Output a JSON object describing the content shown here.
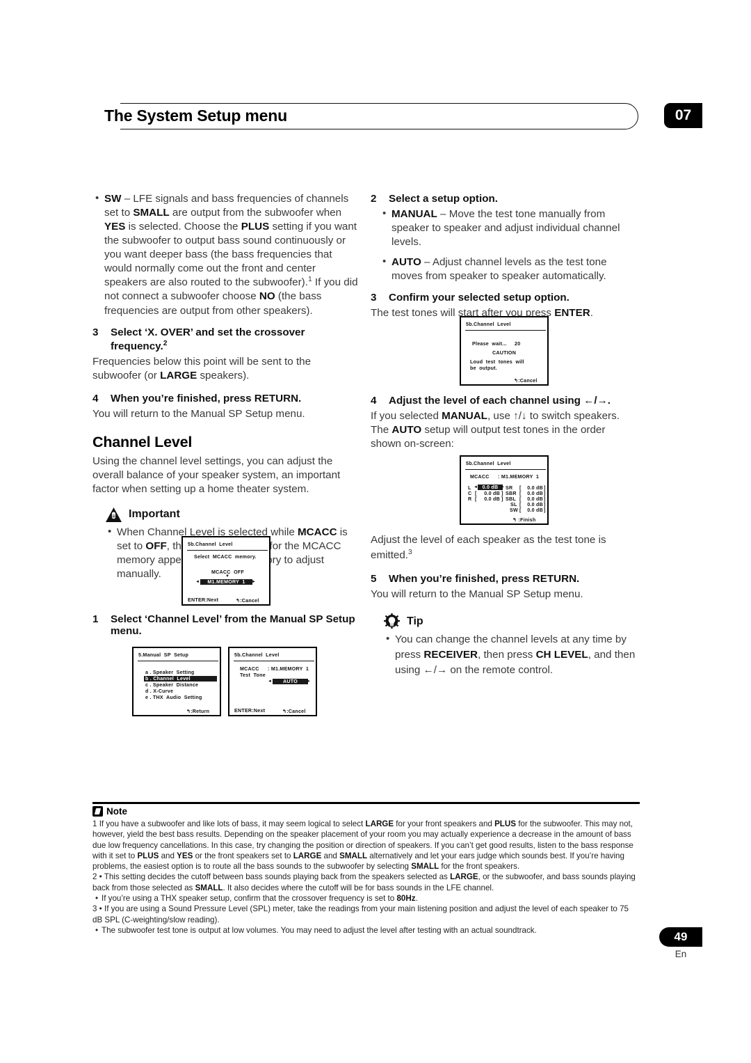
{
  "header": {
    "title": "The System Setup menu",
    "chapter": "07"
  },
  "left_column": {
    "sw_bullet": {
      "lead": "SW",
      "text_1": " – LFE signals and bass frequencies of channels set to ",
      "b_small": "SMALL",
      "text_2": " are output from the subwoofer when ",
      "b_yes": "YES",
      "text_3": " is selected. Choose the ",
      "b_plus": "PLUS",
      "text_4": " setting if you want the subwoofer to output bass sound continuously or you want deeper bass (the bass frequencies that would normally come out the front and center speakers are also routed to the subwoofer).",
      "fn_1": "1",
      "text_5": " If you did not connect a subwoofer choose ",
      "b_no": "NO",
      "text_6": " (the bass frequencies are output from other speakers)."
    },
    "step3": {
      "num": "3",
      "title_a": "Select ‘X. OVER’ and set the crossover frequency.",
      "title_fn": "2",
      "body_a": "Frequencies below this point will be sent to the subwoofer (or ",
      "body_b": "LARGE",
      "body_c": " speakers)."
    },
    "step4": {
      "num": "4",
      "title": "When you’re finished, press RETURN.",
      "body": "You will return to the Manual SP Setup menu."
    },
    "section_title": "Channel Level",
    "section_body": "Using the channel level settings, you can adjust the overall balance of your speaker system, an important factor when setting up a home theater system.",
    "important": {
      "icon": "warning-triangle-icon",
      "label": "Important",
      "text_a": "When Channel Level is selected while ",
      "b_mcacc": "MCACC",
      "text_b": " is set to ",
      "b_off": "OFF",
      "text_c": ", the selection screen for the MCACC memory appears. Select a memory to adjust manually."
    },
    "step1": {
      "num": "1",
      "title": "Select ‘Channel Level’ from the Manual SP Setup menu."
    }
  },
  "right_column": {
    "step2": {
      "num": "2",
      "title": "Select a setup option.",
      "bullet_manual_b": "MANUAL",
      "bullet_manual_t": " – Move the test tone manually from speaker to speaker and adjust individual channel levels.",
      "bullet_auto_b": "AUTO",
      "bullet_auto_t": " – Adjust channel levels as the test tone moves from speaker to speaker automatically."
    },
    "step3": {
      "num": "3",
      "title": "Confirm your selected setup option.",
      "body_a": "The test tones will start after you press ",
      "body_b": "ENTER",
      "body_c": "."
    },
    "step4": {
      "num": "4",
      "title_a": "Adjust the level of each channel using ",
      "title_arrows": "←/→",
      "title_b": ".",
      "body_a": "If you selected ",
      "body_mb": "MANUAL",
      "body_b": ", use ",
      "body_arrows": "↑/↓",
      "body_c": " to switch speakers. The ",
      "body_ab": "AUTO",
      "body_d": " setup will output test tones in the order shown on-screen:"
    },
    "after_osd": {
      "text": "Adjust the level of each speaker as the test tone is emitted.",
      "fn": "3"
    },
    "step5": {
      "num": "5",
      "title": "When you’re finished, press RETURN.",
      "body": "You will return to the Manual SP Setup menu."
    },
    "tip": {
      "icon": "lightbulb-icon",
      "label": "Tip",
      "text_a": "You can change the channel levels at any time by press ",
      "b_receiver": "RECEIVER",
      "text_b": ", then press ",
      "b_chlevel": "CH LEVEL",
      "text_c": ", and then using ",
      "arrows": "←/→",
      "text_d": " on the remote control."
    }
  },
  "osd_screens": {
    "mcacc_memory": {
      "title": "5b.Channel  Level",
      "line1": "Select  MCACC  memory.",
      "line2": "MCACC  OFF",
      "arrow_down": "▼",
      "left_arrow": "◄",
      "selection": "M1.MEMORY  1",
      "right_arrow": "►",
      "footer_left": "ENTER:Next",
      "footer_right": "↰:Cancel"
    },
    "manual_sp_setup": {
      "title": "5.Manual  SP  Setup",
      "items": [
        "a . Speaker  Setting",
        "b . Channel  Level",
        "c . Speaker  Distance",
        "d . X-Curve",
        "e . THX  Audio  Setting"
      ],
      "selected_index": 1,
      "footer_right": "↰:Return"
    },
    "test_tone": {
      "title": "5b.Channel  Level",
      "row1_label": "MCACC",
      "row1_value": ": M1.MEMORY  1",
      "row2_label": "Test  Tone",
      "left_arrow": "◄",
      "selection": "AUTO",
      "right_arrow": "►",
      "footer_left": "ENTER:Next",
      "footer_right": "↰:Cancel"
    },
    "please_wait": {
      "title": "5b.Channel  Level",
      "wait_text": "Please  wait...",
      "wait_count": "20",
      "caution": "CAUTION",
      "warn_line1": "Loud  test  tones  will",
      "warn_line2": "be  output.",
      "footer_right": "↰:Cancel"
    },
    "channel_levels": {
      "title": "5b.Channel  Level",
      "mcacc_label": "MCACC",
      "mcacc_value": ": M1.MEMORY  1",
      "left_rows": [
        {
          "ch": "L",
          "value": "0.0 dB",
          "selected": true
        },
        {
          "ch": "C",
          "value": "0.0 dB",
          "selected": false
        },
        {
          "ch": "R",
          "value": "0.0 dB",
          "selected": false
        }
      ],
      "right_rows": [
        {
          "ch": "SR",
          "value": "0.0 dB"
        },
        {
          "ch": "SBR",
          "value": "0.0 dB"
        },
        {
          "ch": "SBL",
          "value": "0.0 dB"
        },
        {
          "ch": "SL",
          "value": "0.0 dB"
        },
        {
          "ch": "SW",
          "value": "0.0 dB"
        }
      ],
      "left_arrow": "◄",
      "right_arrow": "►",
      "footer_right": "↰ :Finish"
    }
  },
  "notes": {
    "label": "Note",
    "n1": {
      "num": "1",
      "seg_a": "If you have a subwoofer and like lots of bass, it may seem logical to select ",
      "b1": "LARGE",
      "seg_b": " for your front speakers and ",
      "b2": "PLUS",
      "seg_c": " for the subwoofer. This may not, however, yield the best bass results. Depending on the speaker placement of your room you may actually experience a decrease in the amount of bass due low frequency cancellations. In this case, try changing the position or direction of speakers. If you can’t get good results, listen to the bass response with it set to ",
      "b3": "PLUS",
      "seg_d": " and ",
      "b4": "YES",
      "seg_e": " or the front speakers set to ",
      "b5": "LARGE",
      "seg_f": " and ",
      "b6": "SMALL",
      "seg_g": " alternatively and let your ears judge which sounds best. If you’re having problems, the easiest option is to route all the bass sounds to the subwoofer by selecting ",
      "b7": "SMALL",
      "seg_h": " for the front speakers."
    },
    "n2": {
      "num": "2",
      "seg_a": "This setting decides the cutoff between bass sounds playing back from the speakers selected as ",
      "b1": "LARGE",
      "seg_b": ", or the subwoofer, and bass sounds playing back from those selected as ",
      "b2": "SMALL",
      "seg_c": ". It also decides where the cutoff will be for bass sounds in the LFE channel.",
      "sub_a": "If you’re using a THX speaker setup, confirm that the crossover frequency is set to ",
      "sub_b": "80Hz",
      "sub_c": "."
    },
    "n3": {
      "num": "3",
      "seg_a": "If you are using a Sound Pressure Level (SPL) meter, take the readings from your main listening position and adjust the level of each speaker to 75 dB SPL (C-weighting/slow reading).",
      "sub_a": "The subwoofer test tone is output at low volumes. You may need to adjust the level after testing with an actual soundtrack."
    }
  },
  "footer": {
    "page": "49",
    "lang": "En"
  }
}
